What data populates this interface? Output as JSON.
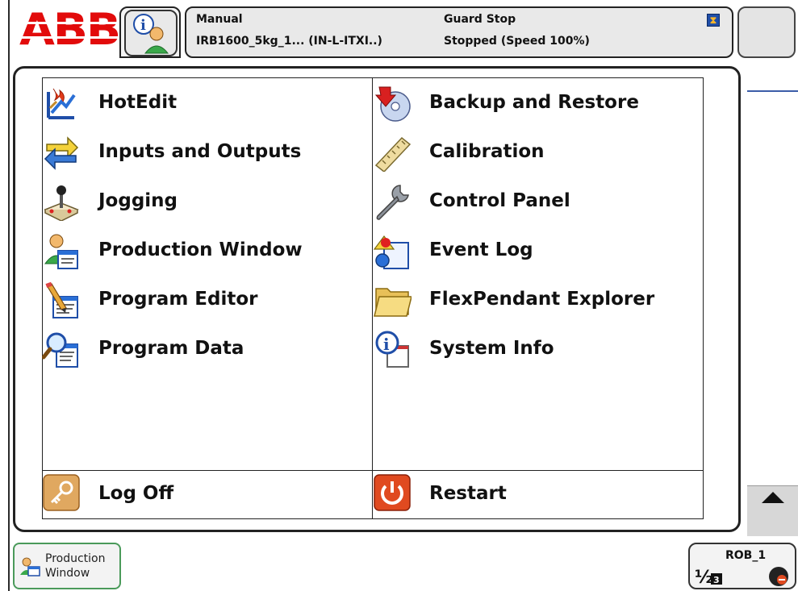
{
  "header": {
    "logo": "ABB",
    "mode": "Manual",
    "system": "IRB1600_5kg_1... (IN-L-ITXI..)",
    "guard": "Guard Stop",
    "state": "Stopped (Speed 100%)"
  },
  "menu": {
    "left": [
      {
        "label": "HotEdit",
        "icon": "hotedit-icon"
      },
      {
        "label": "Inputs and Outputs",
        "icon": "io-arrows-icon"
      },
      {
        "label": "Jogging",
        "icon": "joystick-icon"
      },
      {
        "label": "Production Window",
        "icon": "production-window-icon"
      },
      {
        "label": "Program Editor",
        "icon": "program-editor-icon"
      },
      {
        "label": "Program Data",
        "icon": "program-data-icon"
      }
    ],
    "right": [
      {
        "label": "Backup and Restore",
        "icon": "backup-disc-icon"
      },
      {
        "label": "Calibration",
        "icon": "ruler-icon"
      },
      {
        "label": "Control Panel",
        "icon": "wrench-icon"
      },
      {
        "label": "Event Log",
        "icon": "event-log-icon"
      },
      {
        "label": "FlexPendant Explorer",
        "icon": "folder-icon"
      },
      {
        "label": "System Info",
        "icon": "system-info-icon"
      }
    ],
    "log_off": "Log Off",
    "restart": "Restart"
  },
  "taskbar": {
    "production_window_line1": "Production",
    "production_window_line2": "Window",
    "rob_label": "ROB_1"
  },
  "colors": {
    "abb_red": "#e20b0b",
    "green_border": "#4a9a5a",
    "accent_blue": "#3b5da8"
  }
}
